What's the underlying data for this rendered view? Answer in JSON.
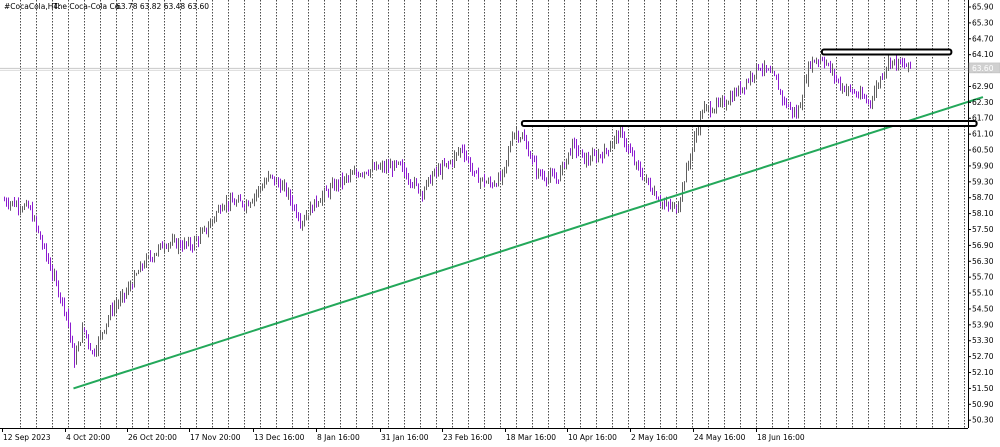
{
  "header": {
    "symbol": "#CocaCola,H4:",
    "name": "The Coca-Cola Co.",
    "ohlc": "63.78 63.82 63.48 63.60"
  },
  "price_badge": "63.60",
  "colors": {
    "bull": "#606060",
    "bear": "#8b1ccf",
    "trendline": "#23a85a",
    "resistance": "#000000",
    "grid": "#000000",
    "bid_line": "#c8c8c8"
  },
  "chart_data": {
    "type": "candlestick",
    "title": "",
    "xlabel": "",
    "ylabel": "",
    "ylim": [
      50.2,
      66.4
    ],
    "grid": "vertical dotted",
    "y_ticks": [
      "65.90",
      "65.30",
      "64.70",
      "64.10",
      "63.50",
      "62.90",
      "62.30",
      "61.70",
      "61.10",
      "60.50",
      "59.90",
      "59.30",
      "58.70",
      "58.10",
      "57.50",
      "56.90",
      "56.30",
      "55.70",
      "55.10",
      "54.50",
      "53.90",
      "53.30",
      "52.70",
      "52.10",
      "51.50",
      "50.90",
      "50.30"
    ],
    "x_ticks": [
      "12 Sep 2023",
      "4 Oct 20:00",
      "26 Oct 20:00",
      "17 Nov 20:00",
      "13 Dec 16:00",
      "8 Jan 16:00",
      "31 Jan 16:00",
      "23 Feb 16:00",
      "18 Mar 16:00",
      "10 Apr 16:00",
      "2 May 16:00",
      "24 May 16:00",
      "18 Jun 16:00"
    ],
    "anchors": [
      [
        "12 Sep 2023",
        58.6
      ],
      [
        "20 Sep 2023",
        58.3
      ],
      [
        "25 Sep 2023",
        56.6
      ],
      [
        "2 Oct 2023",
        54.2
      ],
      [
        "4 Oct 2023",
        52.5
      ],
      [
        "7 Oct 2023",
        53.8
      ],
      [
        "10 Oct 2023",
        52.8
      ],
      [
        "16 Oct 2023",
        54.5
      ],
      [
        "20 Oct 2023",
        55.0
      ],
      [
        "26 Oct 2023",
        56.2
      ],
      [
        "2 Nov 2023",
        57.0
      ],
      [
        "10 Nov 2023",
        56.9
      ],
      [
        "15 Nov 2023",
        57.5
      ],
      [
        "20 Nov 2023",
        58.5
      ],
      [
        "28 Nov 2023",
        58.5
      ],
      [
        "5 Dec 2023",
        59.5
      ],
      [
        "10 Dec 2023",
        59.0
      ],
      [
        "15 Dec 2023",
        57.8
      ],
      [
        "20 Dec 2023",
        58.6
      ],
      [
        "26 Dec 2023",
        59.2
      ],
      [
        "3 Jan 2024",
        59.7
      ],
      [
        "8 Jan 2024",
        59.8
      ],
      [
        "15 Jan 2024",
        59.9
      ],
      [
        "22 Jan 2024",
        58.9
      ],
      [
        "26 Jan 2024",
        59.6
      ],
      [
        "31 Jan 2024",
        60.0
      ],
      [
        "4 Feb 2024",
        60.6
      ],
      [
        "8 Feb 2024",
        59.5
      ],
      [
        "13 Feb 2024",
        59.2
      ],
      [
        "17 Feb 2024",
        59.5
      ],
      [
        "20 Feb 2024",
        61.2
      ],
      [
        "23 Feb 2024",
        61.0
      ],
      [
        "28 Feb 2024",
        59.6
      ],
      [
        "5 Mar 2024",
        59.4
      ],
      [
        "10 Mar 2024",
        60.7
      ],
      [
        "14 Mar 2024",
        60.1
      ],
      [
        "20 Mar 2024",
        60.4
      ],
      [
        "25 Mar 2024",
        61.2
      ],
      [
        "30 Mar 2024",
        59.9
      ],
      [
        "3 Apr 2024",
        59.2
      ],
      [
        "8 Apr 2024",
        58.4
      ],
      [
        "12 Apr 2024",
        58.3
      ],
      [
        "16 Apr 2024",
        60.2
      ],
      [
        "20 Apr 2024",
        62.0
      ],
      [
        "26 Apr 2024",
        62.2
      ],
      [
        "2 May 2024",
        62.8
      ],
      [
        "8 May 2024",
        63.7
      ],
      [
        "13 May 2024",
        63.2
      ],
      [
        "16 May 2024",
        62.3
      ],
      [
        "20 May 2024",
        61.8
      ],
      [
        "24 May 2024",
        63.8
      ],
      [
        "28 May 2024",
        64.0
      ],
      [
        "3 Jun 2024",
        62.9
      ],
      [
        "8 Jun 2024",
        62.6
      ],
      [
        "12 Jun 2024",
        62.3
      ],
      [
        "18 Jun 2024",
        63.9
      ],
      [
        "20 Jun 2024",
        63.8
      ],
      [
        "25 Jun 2024",
        63.6
      ]
    ],
    "trendline": {
      "from": [
        "4 Oct 2023",
        51.5
      ],
      "to": [
        "18 Jul 2024",
        62.5
      ]
    },
    "resistance_lines": [
      {
        "from": [
          "23 Feb 2024",
          61.5
        ],
        "to": [
          "16 Jul 2024",
          61.5
        ]
      },
      {
        "from": [
          "28 May 2024",
          64.2
        ],
        "to": [
          "8 Jul 2024",
          64.2
        ]
      }
    ],
    "last_price": 63.6
  }
}
